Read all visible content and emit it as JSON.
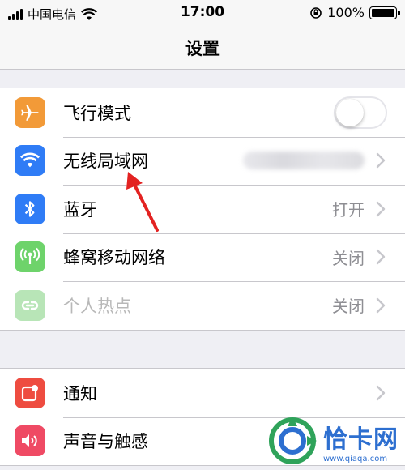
{
  "status_bar": {
    "carrier": "中国电信",
    "time": "17:00",
    "battery": "100%"
  },
  "nav": {
    "title": "设置"
  },
  "group1": [
    {
      "label": "飞行模式",
      "icon": "airplane-icon",
      "color": "#f29a38",
      "control": "toggle",
      "toggle_on": false
    },
    {
      "label": "无线局域网",
      "icon": "wifi-icon",
      "color": "#2f7cf6",
      "control": "blurred-value"
    },
    {
      "label": "蓝牙",
      "icon": "bluetooth-icon",
      "color": "#2f7cf6",
      "value": "打开"
    },
    {
      "label": "蜂窝移动网络",
      "icon": "cellular-icon",
      "color": "#6ed36b",
      "value": "关闭"
    },
    {
      "label": "个人热点",
      "icon": "hotspot-icon",
      "color": "#b8e5b7",
      "value": "关闭",
      "dimmed": true
    }
  ],
  "group2": [
    {
      "label": "通知",
      "icon": "notification-icon",
      "color": "#ee4c40"
    },
    {
      "label": "声音与触感",
      "icon": "sound-icon",
      "color": "#ef4a64"
    }
  ],
  "watermark": {
    "title": "恰卡网",
    "url": "www.qiaqa.com"
  },
  "colors": {
    "chevron": "#c7c7cc",
    "arrow": "#e32221",
    "watermark": "#2d6fd0"
  }
}
